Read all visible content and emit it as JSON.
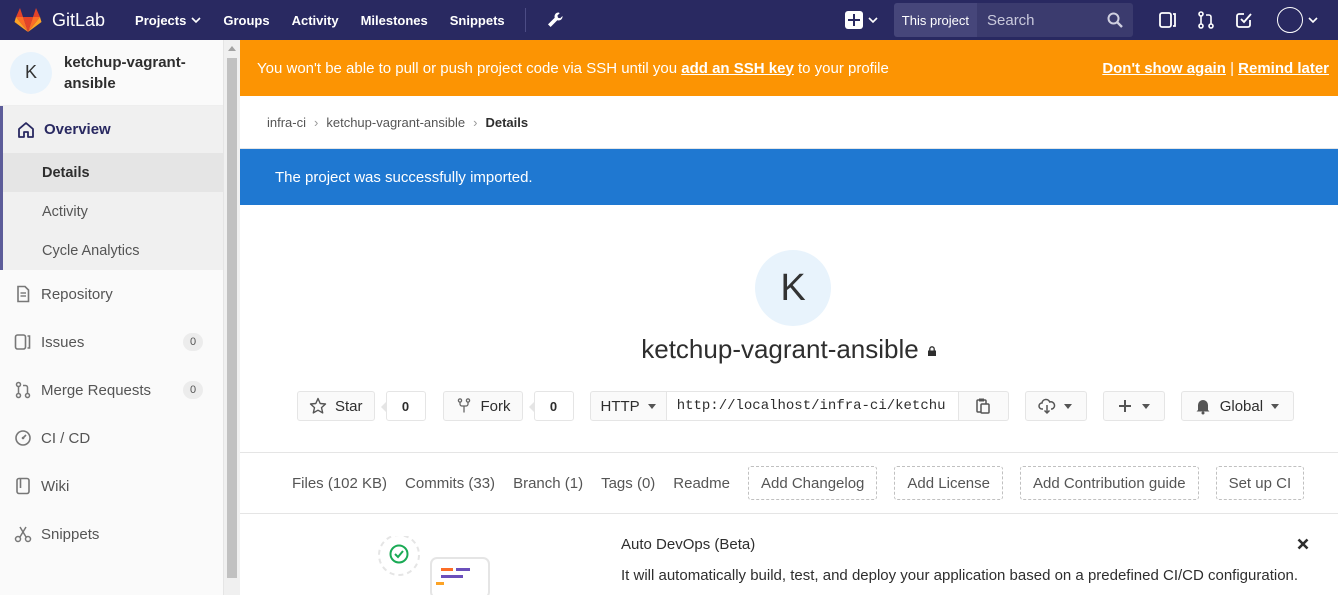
{
  "nav": {
    "brand": "GitLab",
    "links": [
      "Projects",
      "Groups",
      "Activity",
      "Milestones",
      "Snippets"
    ],
    "search_scope": "This project",
    "search_placeholder": "Search"
  },
  "sidebar": {
    "avatar_letter": "K",
    "project_name": "ketchup-vagrant-ansible",
    "overview": "Overview",
    "overview_items": [
      "Details",
      "Activity",
      "Cycle Analytics"
    ],
    "items": [
      {
        "label": "Repository"
      },
      {
        "label": "Issues",
        "count": "0"
      },
      {
        "label": "Merge Requests",
        "count": "0"
      },
      {
        "label": "CI / CD"
      },
      {
        "label": "Wiki"
      },
      {
        "label": "Snippets"
      }
    ]
  },
  "ssh_banner": {
    "text_before": "You won't be able to pull or push project code via SSH until you ",
    "link": "add an SSH key",
    "text_after": " to your profile",
    "dont_show": "Don't show again",
    "separator": "|",
    "remind": "Remind later"
  },
  "breadcrumb": [
    "infra-ci",
    "ketchup-vagrant-ansible",
    "Details"
  ],
  "flash": "The project was successfully imported.",
  "project": {
    "avatar_letter": "K",
    "title": "ketchup-vagrant-ansible",
    "star_label": "Star",
    "star_count": "0",
    "fork_label": "Fork",
    "fork_count": "0",
    "clone_protocol": "HTTP",
    "clone_url": "http://localhost/infra-ci/ketchu",
    "notification": "Global"
  },
  "stats": {
    "files": "Files (102 KB)",
    "commits": "Commits (33)",
    "branch": "Branch (1)",
    "tags": "Tags (0)",
    "readme": "Readme",
    "add_changelog": "Add Changelog",
    "add_license": "Add License",
    "add_contribution": "Add Contribution guide",
    "setup_ci": "Set up CI"
  },
  "autodevops": {
    "title": "Auto DevOps (Beta)",
    "description": "It will automatically build, test, and deploy your application based on a predefined CI/CD configuration."
  },
  "colors": {
    "nav_bg": "#292961",
    "warning_bg": "#fc9403",
    "info_bg": "#1f78d1"
  }
}
